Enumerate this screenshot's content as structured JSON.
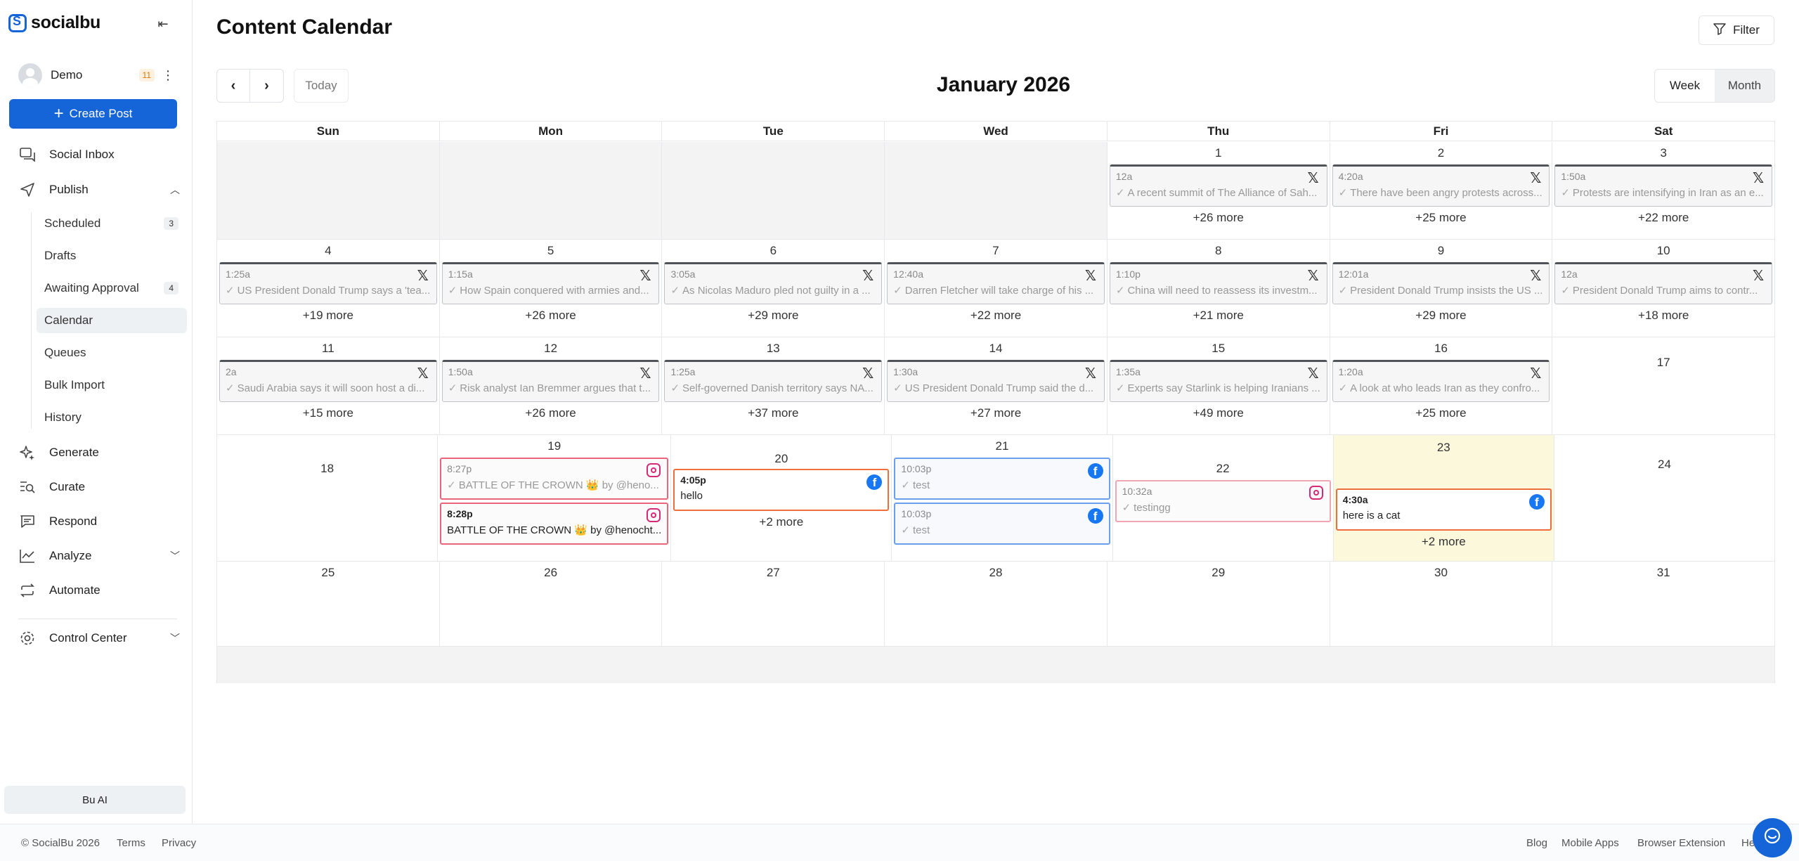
{
  "app": {
    "logo_text": "socialbu"
  },
  "user": {
    "name": "Demo",
    "notifications": "11"
  },
  "sidebar": {
    "create_post": "Create Post",
    "nav": [
      {
        "label": "Social Inbox",
        "icon": "inbox-icon"
      },
      {
        "label": "Publish",
        "icon": "send-icon"
      },
      {
        "label": "Generate",
        "icon": "sparkle-icon"
      },
      {
        "label": "Curate",
        "icon": "curate-icon"
      },
      {
        "label": "Respond",
        "icon": "chat-icon"
      },
      {
        "label": "Analyze",
        "icon": "chart-icon"
      },
      {
        "label": "Automate",
        "icon": "repeat-icon"
      },
      {
        "label": "Control Center",
        "icon": "gear-icon"
      }
    ],
    "publish_sub": [
      {
        "label": "Scheduled",
        "count": "3"
      },
      {
        "label": "Drafts",
        "count": ""
      },
      {
        "label": "Awaiting Approval",
        "count": "4"
      },
      {
        "label": "Calendar",
        "count": ""
      },
      {
        "label": "Queues",
        "count": ""
      },
      {
        "label": "Bulk Import",
        "count": ""
      },
      {
        "label": "History",
        "count": ""
      }
    ],
    "bu_ai": "Bu AI"
  },
  "header": {
    "title": "Content Calendar",
    "filter": "Filter"
  },
  "toolbar": {
    "today": "Today",
    "month_title": "January 2026",
    "week": "Week",
    "month": "Month"
  },
  "calendar": {
    "days_of_week": [
      "Sun",
      "Mon",
      "Tue",
      "Wed",
      "Thu",
      "Fri",
      "Sat"
    ],
    "week1": {
      "d1": {
        "num": "1",
        "time": "12a",
        "text": "A recent summit of The Alliance of Sah...",
        "more": "+26 more"
      },
      "d2": {
        "num": "2",
        "time": "4:20a",
        "text": "There have been angry protests across...",
        "more": "+25 more"
      },
      "d3": {
        "num": "3",
        "time": "1:50a",
        "text": "Protests are intensifying in Iran as an e...",
        "more": "+22 more"
      }
    },
    "week2": [
      {
        "num": "4",
        "time": "1:25a",
        "text": "US President Donald Trump says a 'tea...",
        "more": "+19 more"
      },
      {
        "num": "5",
        "time": "1:15a",
        "text": "How Spain conquered with armies and...",
        "more": "+26 more"
      },
      {
        "num": "6",
        "time": "3:05a",
        "text": "As Nicolas Maduro pled not guilty in a ...",
        "more": "+29 more"
      },
      {
        "num": "7",
        "time": "12:40a",
        "text": "Darren Fletcher will take charge of his ...",
        "more": "+22 more"
      },
      {
        "num": "8",
        "time": "1:10p",
        "text": "China will need to reassess its investm...",
        "more": "+21 more"
      },
      {
        "num": "9",
        "time": "12:01a",
        "text": "President Donald Trump insists the US ...",
        "more": "+29 more"
      },
      {
        "num": "10",
        "time": "12a",
        "text": "President Donald Trump aims to contr...",
        "more": "+18 more"
      }
    ],
    "week3": [
      {
        "num": "11",
        "time": "2a",
        "text": "Saudi Arabia says it will soon host a di...",
        "more": "+15 more"
      },
      {
        "num": "12",
        "time": "1:50a",
        "text": "Risk analyst Ian Bremmer argues that t...",
        "more": "+26 more"
      },
      {
        "num": "13",
        "time": "1:25a",
        "text": "Self-governed Danish territory says NA...",
        "more": "+37 more"
      },
      {
        "num": "14",
        "time": "1:30a",
        "text": "US President Donald Trump said the d...",
        "more": "+27 more"
      },
      {
        "num": "15",
        "time": "1:35a",
        "text": "Experts say Starlink is helping Iranians ...",
        "more": "+49 more"
      },
      {
        "num": "16",
        "time": "1:20a",
        "text": "A look at who leads Iran as they confro...",
        "more": "+25 more"
      },
      {
        "num": "17"
      }
    ],
    "week4": {
      "d18": "18",
      "d19": {
        "num": "19",
        "p1_time": "8:27p",
        "p1_text": "BATTLE OF THE CROWN 👑 by @heno...",
        "p2_time": "8:28p",
        "p2_text": "BATTLE OF THE CROWN 👑 by @henocht..."
      },
      "d20": {
        "num": "20",
        "time": "4:05p",
        "text": "hello",
        "more": "+2 more"
      },
      "d21": {
        "num": "21",
        "p1_time": "10:03p",
        "p1_text": "test",
        "p2_time": "10:03p",
        "p2_text": "test"
      },
      "d22": {
        "num": "22",
        "time": "10:32a",
        "text": "testingg"
      },
      "d23": {
        "num": "23",
        "time": "4:30a",
        "text": "here is a cat",
        "more": "+2 more"
      },
      "d24": "24"
    },
    "week5": [
      "25",
      "26",
      "27",
      "28",
      "29",
      "30",
      "31"
    ]
  },
  "footer": {
    "copyright": "© SocialBu 2026",
    "terms": "Terms",
    "privacy": "Privacy",
    "blog": "Blog",
    "mobile_apps": "Mobile Apps",
    "browser_extension": "Browser Extension",
    "help": "Help"
  },
  "colors": {
    "brand": "#1565d8",
    "today_bg": "#fcf8dc",
    "instagram": "#d62976",
    "facebook": "#1877f2"
  }
}
